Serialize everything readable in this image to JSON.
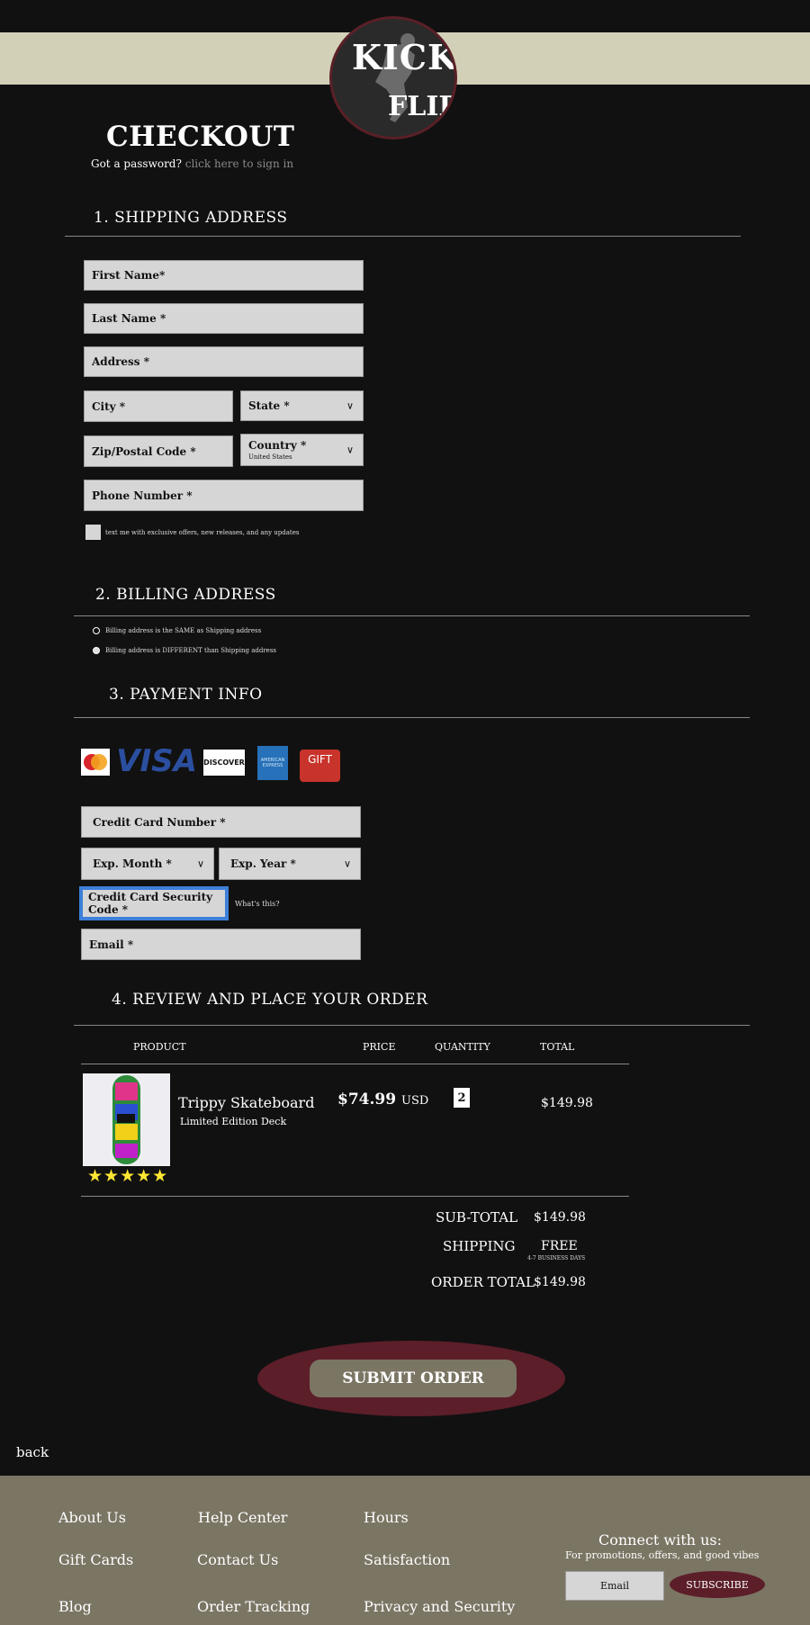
{
  "brand": {
    "logo_line1": "KICK",
    "logo_line2": "FLIP"
  },
  "header": {
    "title": "CHECKOUT",
    "password_prompt": "Got a password?",
    "signin_link": "click here to sign in"
  },
  "shipping": {
    "title": "1. SHIPPING ADDRESS",
    "first_name": "First Name*",
    "last_name": "Last Name *",
    "address": "Address *",
    "city": "City *",
    "state": "State *",
    "zip": "Zip/Postal Code *",
    "country": "Country *",
    "country_value": "United States",
    "phone": "Phone Number *",
    "text_optin": "text me with exclusive offers, new releases, and any updates"
  },
  "billing": {
    "title": "2. BILLING ADDRESS",
    "same": "Billing address is the SAME as Shipping address",
    "different": "Billing address is DIFFERENT than Shipping address"
  },
  "payment": {
    "title": "3. PAYMENT INFO",
    "mastercard": "MasterCard",
    "visa": "VISA",
    "discover": "DISCOVER",
    "amex": "AMERICAN EXPRESS",
    "gift": "GIFT",
    "card_number": "Credit Card Number *",
    "exp_month": "Exp. Month *",
    "exp_year": "Exp. Year *",
    "security_code": "Credit Card Security Code *",
    "whats_this": "What's this?",
    "email": "Email *"
  },
  "review": {
    "title": "4. REVIEW AND PLACE YOUR ORDER",
    "headers": {
      "product": "PRODUCT",
      "price": "PRICE",
      "quantity": "QUANTITY",
      "total": "TOTAL"
    },
    "item": {
      "name": "Trippy Skateboard",
      "description": "Limited Edition Deck",
      "price": "$74.99",
      "currency": "USD",
      "quantity": "2",
      "total": "$149.98",
      "stars": "★★★★★",
      "rating": 5
    },
    "subtotal_label": "SUB-TOTAL",
    "subtotal": "$149.98",
    "shipping_label": "SHIPPING",
    "shipping": "FREE",
    "shipping_note": "4-7 BUSINESS DAYS",
    "order_total_label": "ORDER TOTAL",
    "order_total": "$149.98"
  },
  "submit": {
    "label": "SUBMIT ORDER"
  },
  "back": "back",
  "footer": {
    "about": "About Us",
    "help": "Help Center",
    "hours": "Hours",
    "gift_cards": "Gift Cards",
    "contact": "Contact Us",
    "satisfaction": "Satisfaction",
    "blog": "Blog",
    "tracking": "Order Tracking",
    "privacy": "Privacy and Security",
    "connect": "Connect with us:",
    "promo": "For promotions, offers, and good vibes",
    "email_placeholder": "Email",
    "subscribe": "SUBSCRIBE"
  },
  "colors": {
    "background": "#111111",
    "top_band": "#d3d0b8",
    "accent_maroon": "#5c1e29",
    "footer": "#7b7564",
    "field": "#d6d6d6",
    "focus": "#3d7fd9"
  }
}
